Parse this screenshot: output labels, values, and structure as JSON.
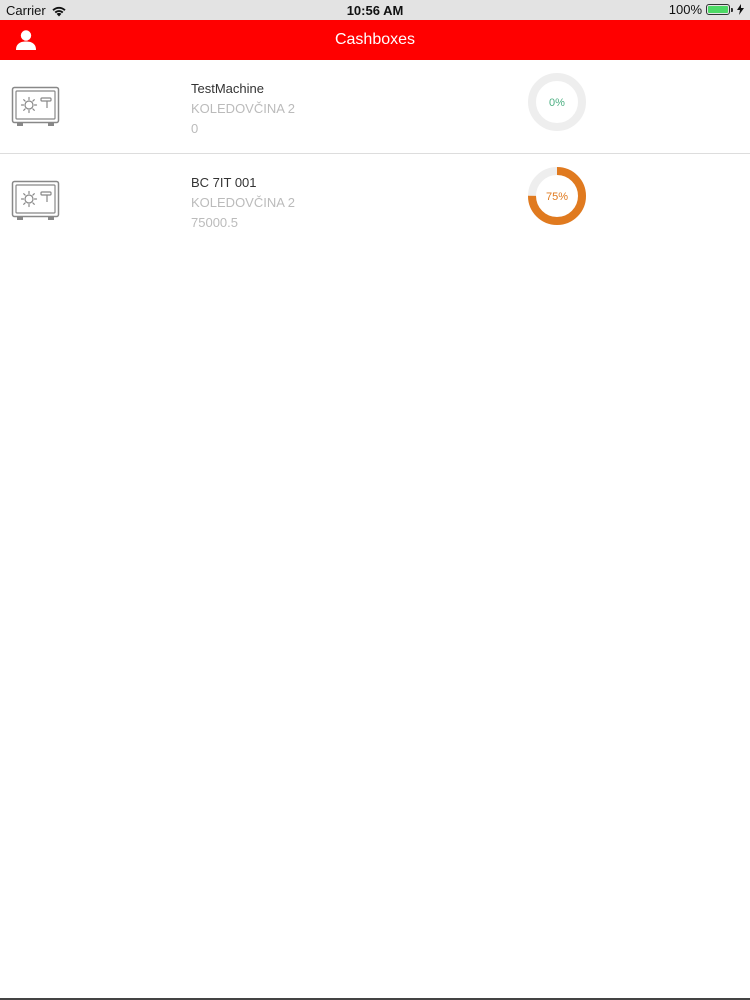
{
  "status_bar": {
    "carrier": "Carrier",
    "time": "10:56 AM",
    "battery_percent": "100%",
    "battery_level": 1.0
  },
  "nav": {
    "title": "Cashboxes",
    "color": "#ff0000",
    "user_icon": "person-icon"
  },
  "cashboxes": [
    {
      "name": "TestMachine",
      "address": "KOLEDOVČINA 2",
      "amount": "0",
      "fill_percent": 0,
      "fill_label": "0%",
      "gauge_color": "#4caf82",
      "icon": "safe-icon"
    },
    {
      "name": "BC 7IT 001",
      "address": "KOLEDOVČINA 2",
      "amount": "75000.5",
      "fill_percent": 75,
      "fill_label": "75%",
      "gauge_color": "#e07a1f",
      "icon": "safe-icon"
    }
  ]
}
